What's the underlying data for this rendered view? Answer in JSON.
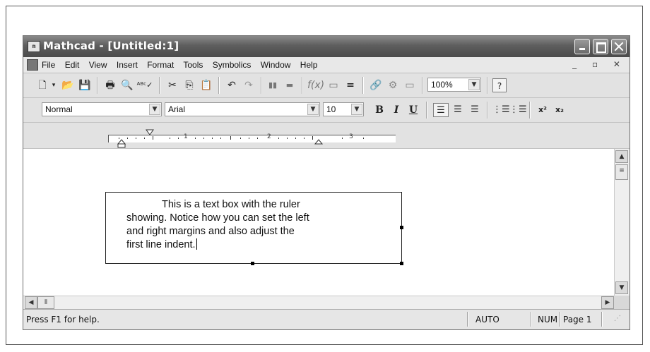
{
  "window": {
    "title": "Mathcad - [Untitled:1]"
  },
  "menu": {
    "items": [
      "File",
      "Edit",
      "View",
      "Insert",
      "Format",
      "Tools",
      "Symbolics",
      "Window",
      "Help"
    ]
  },
  "toolbar": {
    "zoom": "100%"
  },
  "format_bar": {
    "style": "Normal",
    "font": "Arial",
    "size": "10",
    "bold": "B",
    "italic": "I",
    "underline": "U"
  },
  "ruler": {
    "numbers": [
      "1",
      "2",
      "3"
    ]
  },
  "document": {
    "text_lines": [
      "This is a text box with the ruler",
      "showing. Notice how you can set the left",
      "and right margins and also adjust the",
      "first line indent."
    ]
  },
  "status": {
    "help": "Press F1 for help.",
    "mode": "AUTO",
    "num": "NUM",
    "page": "Page 1"
  },
  "colors": {
    "titlebar": "#5e5e5e",
    "window_bg": "#c6c6c6"
  },
  "icons": [
    "new-icon",
    "open-icon",
    "save-icon",
    "print-icon",
    "print-preview-icon",
    "spell-check-icon",
    "cut-icon",
    "copy-icon",
    "paste-icon",
    "undo-icon",
    "redo-icon",
    "align-icon",
    "insert-function-icon",
    "insert-unit-icon",
    "calculate-icon",
    "resource-center-icon",
    "help-icon"
  ]
}
